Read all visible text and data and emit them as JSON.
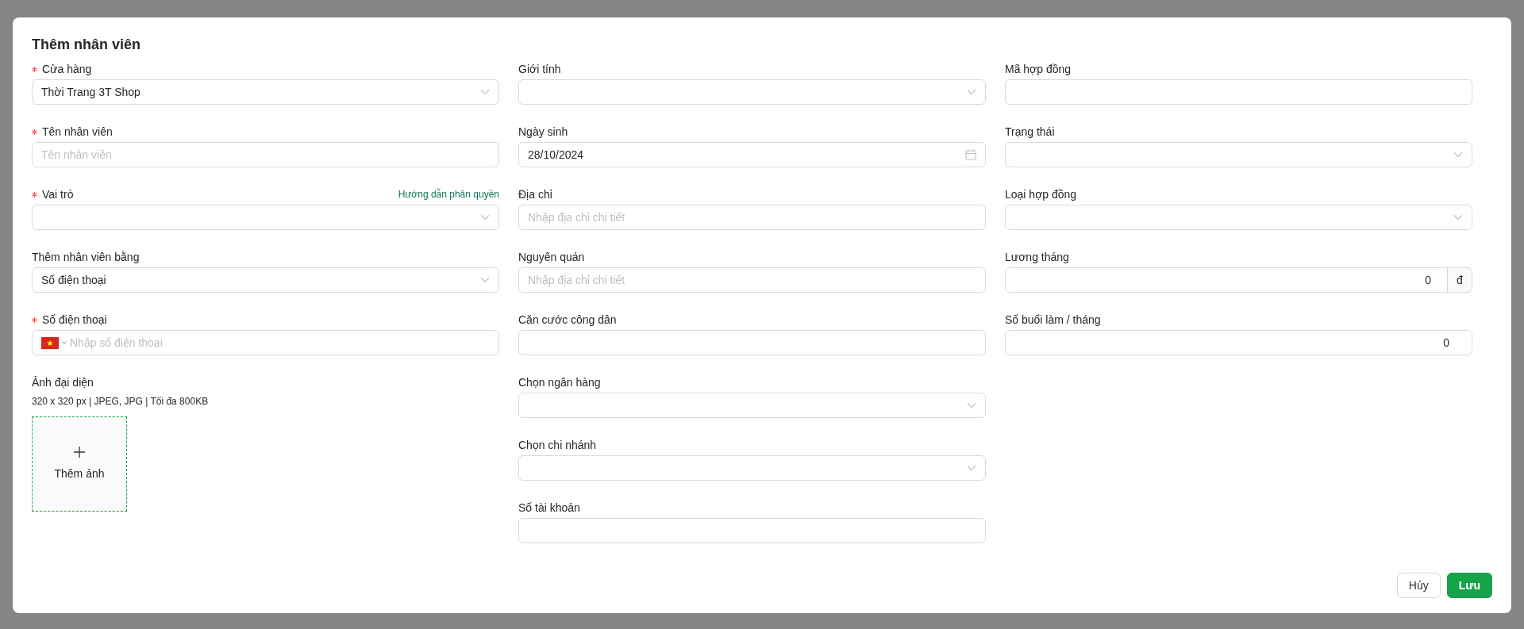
{
  "dialog": {
    "title": "Thêm nhân viên"
  },
  "columns": [
    [
      {
        "kind": "select",
        "label": "Cửa hàng",
        "required": true,
        "value": "Thời Trang 3T Shop"
      },
      {
        "kind": "input",
        "label": "Tên nhân viên",
        "required": true,
        "placeholder": "Tên nhân viên"
      },
      {
        "kind": "select",
        "label": "Vai trò",
        "required": true,
        "link": "Hướng dẫn phân quyền"
      },
      {
        "kind": "select",
        "label": "Thêm nhân viên bằng",
        "required": false,
        "value": "Số điện thoại"
      },
      {
        "kind": "phone",
        "label": "Số điện thoại",
        "required": true,
        "placeholder": "Nhập số điện thoại"
      },
      {
        "kind": "upload",
        "label": "Ảnh đại diện",
        "hint": "320 x 320 px | JPEG, JPG | Tối đa 800KB",
        "button": "Thêm ảnh"
      }
    ],
    [
      {
        "kind": "select",
        "label": "Giới tính",
        "required": false
      },
      {
        "kind": "date",
        "label": "Ngày sinh",
        "required": false,
        "value": "28/10/2024"
      },
      {
        "kind": "input",
        "label": "Địa chỉ",
        "required": false,
        "placeholder": "Nhập địa chỉ chi tiết"
      },
      {
        "kind": "input",
        "label": "Nguyên quán",
        "required": false,
        "placeholder": "Nhập địa chỉ chi tiết"
      },
      {
        "kind": "input",
        "label": "Căn cước công dân",
        "required": false
      },
      {
        "kind": "select",
        "label": "Chọn ngân hàng",
        "required": false
      },
      {
        "kind": "select",
        "label": "Chọn chi nhánh",
        "required": false
      },
      {
        "kind": "input",
        "label": "Số tài khoản",
        "required": false
      }
    ],
    [
      {
        "kind": "input",
        "label": "Mã hợp đồng",
        "required": false
      },
      {
        "kind": "select",
        "label": "Trạng thái",
        "required": false
      },
      {
        "kind": "select",
        "label": "Loại hợp đồng",
        "required": false
      },
      {
        "kind": "number",
        "label": "Lương tháng",
        "required": false,
        "value": "0",
        "suffix": "đ"
      },
      {
        "kind": "number",
        "label": "Số buổi làm / tháng",
        "required": false,
        "value": "0"
      }
    ]
  ],
  "buttons": [
    {
      "kind": "secondary",
      "label": "Hủy"
    },
    {
      "kind": "primary",
      "label": "Lưu"
    }
  ]
}
